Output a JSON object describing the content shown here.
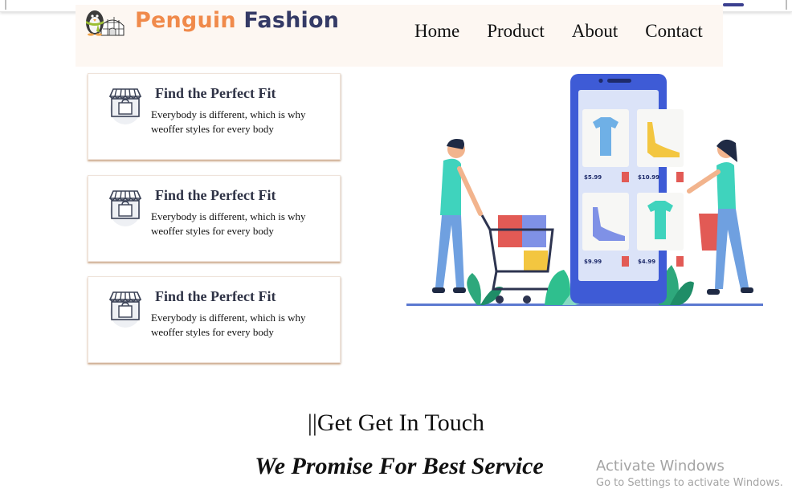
{
  "header": {
    "brand_part1": "Penguin",
    "brand_part2": "Fashion",
    "nav": [
      "Home",
      "Product",
      "About",
      "Contact"
    ]
  },
  "features": [
    {
      "title": "Find the Perfect Fit",
      "text": "Everybody is different, which is why weoffer styles for every body"
    },
    {
      "title": "Find the Perfect Fit",
      "text": "Everybody is different, which is why weoffer styles for every body"
    },
    {
      "title": "Find the Perfect Fit",
      "text": "Everybody is different, which is why weoffer styles for every body"
    }
  ],
  "illustration": {
    "prices": [
      "$5.99",
      "$10.99",
      "$9.99",
      "$4.99"
    ]
  },
  "contact": {
    "heading": "||Get Get In Touch",
    "tagline": "We Promise For Best Service"
  },
  "watermark": {
    "title": "Activate Windows",
    "subtitle": "Go to Settings to activate Windows."
  },
  "colors": {
    "brand_orange": "#f08a4b",
    "brand_navy": "#343a66",
    "header_bg": "#fdf7f2",
    "phone_blue": "#3e5bd6"
  },
  "icons": [
    "penguin-igloo-logo-icon",
    "shop-bag-icon"
  ]
}
